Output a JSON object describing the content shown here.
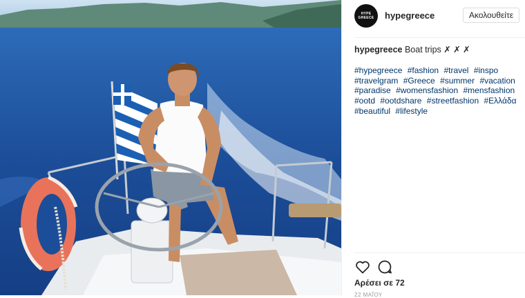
{
  "photo": {
    "alt": "hypegreece boat trip photo"
  },
  "header": {
    "avatar_text": "HYPE GREECE",
    "username": "hypegreece",
    "follow_label": "Ακολουθείτε"
  },
  "caption": {
    "user": "hypegreece",
    "text": "Boat trips ✗ ✗ ✗"
  },
  "hashtags": [
    "#hypegreece",
    "#fashion",
    "#travel",
    "#inspo",
    "#travelgram",
    "#Greece",
    "#summer",
    "#vacation",
    "#paradise",
    "#womensfashion",
    "#mensfashion",
    "#ootd",
    "#ootdshare",
    "#streetfashion",
    "#Ελλάδα",
    "#beautiful",
    "#lifestyle"
  ],
  "actions": {
    "like_icon": "heart-icon",
    "comment_icon": "comment-icon"
  },
  "likes_text": "Αρέσει σε 72",
  "timestamp": "22 ΜΑΐΟΥ",
  "colors": {
    "hashtag": "#003569",
    "text": "#262626",
    "sea": "#1d4f9a"
  }
}
